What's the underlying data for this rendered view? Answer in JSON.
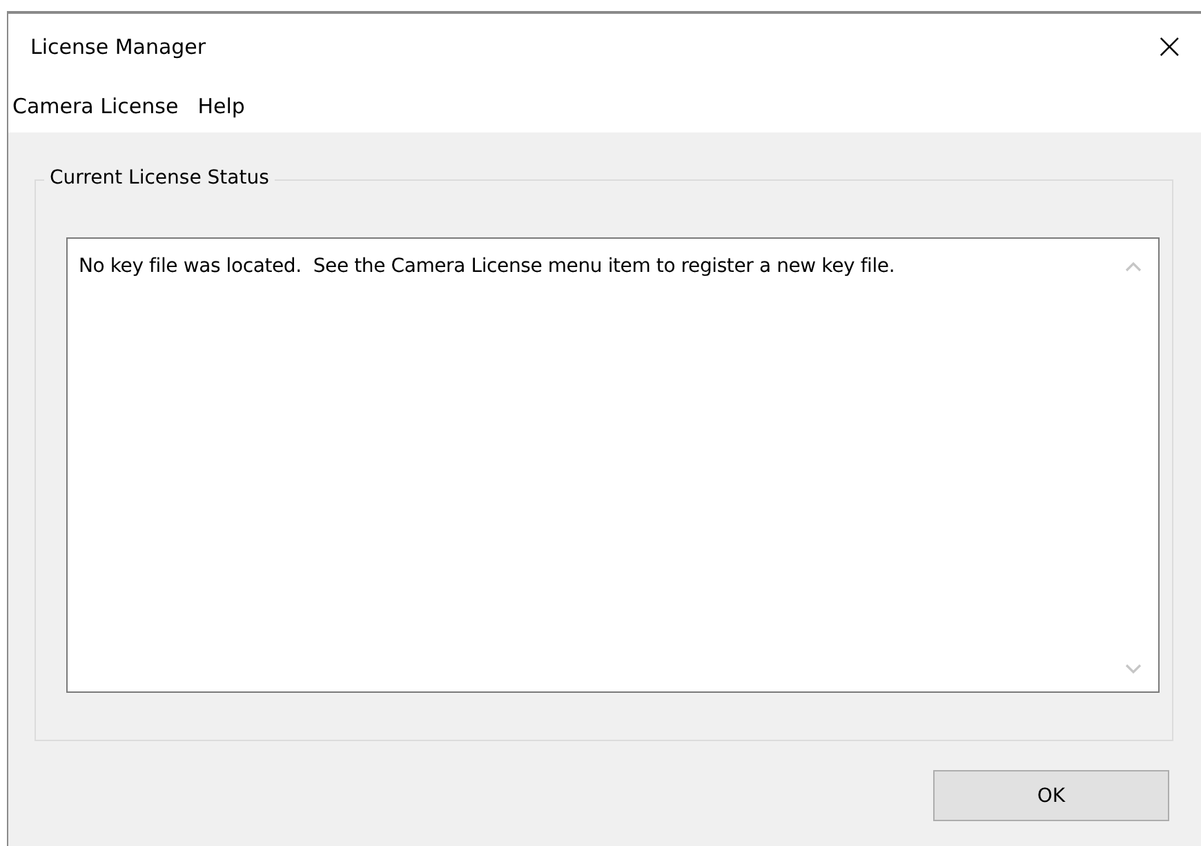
{
  "window": {
    "title": "License Manager",
    "close": "×"
  },
  "menu": [
    {
      "label": "Camera License"
    },
    {
      "label": "Help"
    }
  ],
  "group": {
    "title": "Current License Status",
    "text": "No key file was located.  See the Camera License menu item to register a new key file."
  },
  "buttons": [
    "OK"
  ]
}
